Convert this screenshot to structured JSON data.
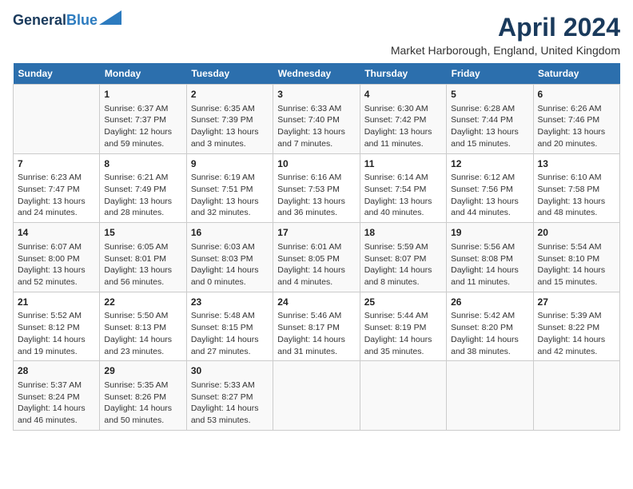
{
  "logo": {
    "line1": "General",
    "line2": "Blue"
  },
  "title": "April 2024",
  "location": "Market Harborough, England, United Kingdom",
  "days_header": [
    "Sunday",
    "Monday",
    "Tuesday",
    "Wednesday",
    "Thursday",
    "Friday",
    "Saturday"
  ],
  "weeks": [
    [
      {
        "day": "",
        "content": ""
      },
      {
        "day": "1",
        "content": "Sunrise: 6:37 AM\nSunset: 7:37 PM\nDaylight: 12 hours\nand 59 minutes."
      },
      {
        "day": "2",
        "content": "Sunrise: 6:35 AM\nSunset: 7:39 PM\nDaylight: 13 hours\nand 3 minutes."
      },
      {
        "day": "3",
        "content": "Sunrise: 6:33 AM\nSunset: 7:40 PM\nDaylight: 13 hours\nand 7 minutes."
      },
      {
        "day": "4",
        "content": "Sunrise: 6:30 AM\nSunset: 7:42 PM\nDaylight: 13 hours\nand 11 minutes."
      },
      {
        "day": "5",
        "content": "Sunrise: 6:28 AM\nSunset: 7:44 PM\nDaylight: 13 hours\nand 15 minutes."
      },
      {
        "day": "6",
        "content": "Sunrise: 6:26 AM\nSunset: 7:46 PM\nDaylight: 13 hours\nand 20 minutes."
      }
    ],
    [
      {
        "day": "7",
        "content": "Sunrise: 6:23 AM\nSunset: 7:47 PM\nDaylight: 13 hours\nand 24 minutes."
      },
      {
        "day": "8",
        "content": "Sunrise: 6:21 AM\nSunset: 7:49 PM\nDaylight: 13 hours\nand 28 minutes."
      },
      {
        "day": "9",
        "content": "Sunrise: 6:19 AM\nSunset: 7:51 PM\nDaylight: 13 hours\nand 32 minutes."
      },
      {
        "day": "10",
        "content": "Sunrise: 6:16 AM\nSunset: 7:53 PM\nDaylight: 13 hours\nand 36 minutes."
      },
      {
        "day": "11",
        "content": "Sunrise: 6:14 AM\nSunset: 7:54 PM\nDaylight: 13 hours\nand 40 minutes."
      },
      {
        "day": "12",
        "content": "Sunrise: 6:12 AM\nSunset: 7:56 PM\nDaylight: 13 hours\nand 44 minutes."
      },
      {
        "day": "13",
        "content": "Sunrise: 6:10 AM\nSunset: 7:58 PM\nDaylight: 13 hours\nand 48 minutes."
      }
    ],
    [
      {
        "day": "14",
        "content": "Sunrise: 6:07 AM\nSunset: 8:00 PM\nDaylight: 13 hours\nand 52 minutes."
      },
      {
        "day": "15",
        "content": "Sunrise: 6:05 AM\nSunset: 8:01 PM\nDaylight: 13 hours\nand 56 minutes."
      },
      {
        "day": "16",
        "content": "Sunrise: 6:03 AM\nSunset: 8:03 PM\nDaylight: 14 hours\nand 0 minutes."
      },
      {
        "day": "17",
        "content": "Sunrise: 6:01 AM\nSunset: 8:05 PM\nDaylight: 14 hours\nand 4 minutes."
      },
      {
        "day": "18",
        "content": "Sunrise: 5:59 AM\nSunset: 8:07 PM\nDaylight: 14 hours\nand 8 minutes."
      },
      {
        "day": "19",
        "content": "Sunrise: 5:56 AM\nSunset: 8:08 PM\nDaylight: 14 hours\nand 11 minutes."
      },
      {
        "day": "20",
        "content": "Sunrise: 5:54 AM\nSunset: 8:10 PM\nDaylight: 14 hours\nand 15 minutes."
      }
    ],
    [
      {
        "day": "21",
        "content": "Sunrise: 5:52 AM\nSunset: 8:12 PM\nDaylight: 14 hours\nand 19 minutes."
      },
      {
        "day": "22",
        "content": "Sunrise: 5:50 AM\nSunset: 8:13 PM\nDaylight: 14 hours\nand 23 minutes."
      },
      {
        "day": "23",
        "content": "Sunrise: 5:48 AM\nSunset: 8:15 PM\nDaylight: 14 hours\nand 27 minutes."
      },
      {
        "day": "24",
        "content": "Sunrise: 5:46 AM\nSunset: 8:17 PM\nDaylight: 14 hours\nand 31 minutes."
      },
      {
        "day": "25",
        "content": "Sunrise: 5:44 AM\nSunset: 8:19 PM\nDaylight: 14 hours\nand 35 minutes."
      },
      {
        "day": "26",
        "content": "Sunrise: 5:42 AM\nSunset: 8:20 PM\nDaylight: 14 hours\nand 38 minutes."
      },
      {
        "day": "27",
        "content": "Sunrise: 5:39 AM\nSunset: 8:22 PM\nDaylight: 14 hours\nand 42 minutes."
      }
    ],
    [
      {
        "day": "28",
        "content": "Sunrise: 5:37 AM\nSunset: 8:24 PM\nDaylight: 14 hours\nand 46 minutes."
      },
      {
        "day": "29",
        "content": "Sunrise: 5:35 AM\nSunset: 8:26 PM\nDaylight: 14 hours\nand 50 minutes."
      },
      {
        "day": "30",
        "content": "Sunrise: 5:33 AM\nSunset: 8:27 PM\nDaylight: 14 hours\nand 53 minutes."
      },
      {
        "day": "",
        "content": ""
      },
      {
        "day": "",
        "content": ""
      },
      {
        "day": "",
        "content": ""
      },
      {
        "day": "",
        "content": ""
      }
    ]
  ]
}
